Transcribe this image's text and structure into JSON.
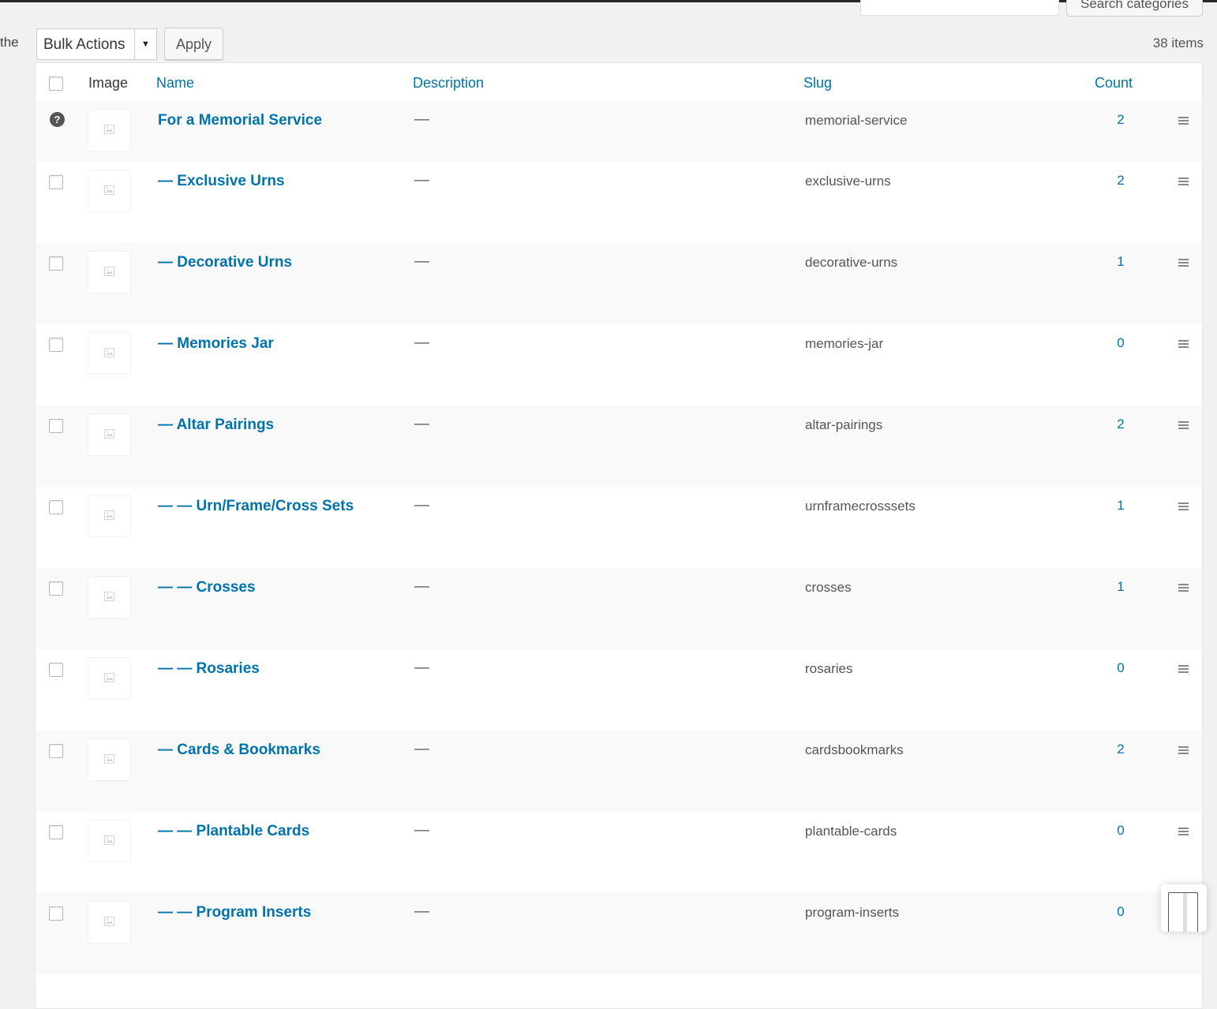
{
  "search": {
    "button_label": "Search categories",
    "placeholder": ""
  },
  "cut_text": "the",
  "bulk_actions": {
    "selected": "Bulk Actions",
    "apply_label": "Apply"
  },
  "items_count": "38 items",
  "columns": {
    "image": "Image",
    "name": "Name",
    "description": "Description",
    "slug": "Slug",
    "count": "Count"
  },
  "rows": [
    {
      "name": "For a Memorial Service",
      "description": "—",
      "slug": "memorial-service",
      "count": "2"
    },
    {
      "name": "— Exclusive Urns",
      "description": "—",
      "slug": "exclusive-urns",
      "count": "2"
    },
    {
      "name": "— Decorative Urns",
      "description": "—",
      "slug": "decorative-urns",
      "count": "1"
    },
    {
      "name": "— Memories Jar",
      "description": "—",
      "slug": "memories-jar",
      "count": "0"
    },
    {
      "name": "— Altar Pairings",
      "description": "—",
      "slug": "altar-pairings",
      "count": "2"
    },
    {
      "name": "— — Urn/Frame/Cross Sets",
      "description": "—",
      "slug": "urnframecrosssets",
      "count": "1"
    },
    {
      "name": "— — Crosses",
      "description": "—",
      "slug": "crosses",
      "count": "1"
    },
    {
      "name": "— — Rosaries",
      "description": "—",
      "slug": "rosaries",
      "count": "0"
    },
    {
      "name": "— Cards & Bookmarks",
      "description": "—",
      "slug": "cardsbookmarks",
      "count": "2"
    },
    {
      "name": "— — Plantable Cards",
      "description": "—",
      "slug": "plantable-cards",
      "count": "0"
    },
    {
      "name": "— — Program Inserts",
      "description": "—",
      "slug": "program-inserts",
      "count": "0"
    }
  ],
  "help_icon_glyph": "?",
  "colors": {
    "link": "#0073aa",
    "admin_bar": "#23282d",
    "background": "#f1f1f1",
    "row_alt": "#f9f9f9"
  }
}
